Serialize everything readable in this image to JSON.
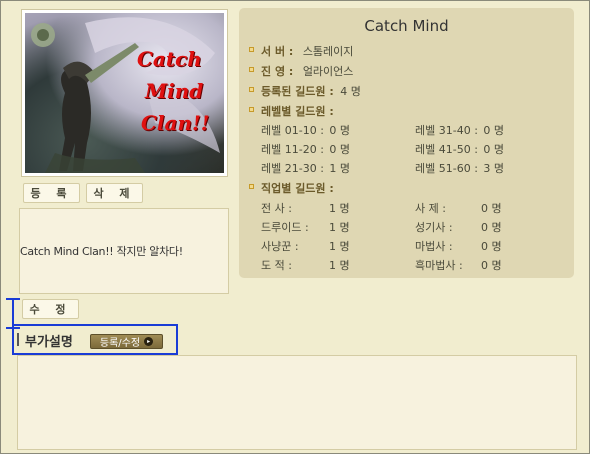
{
  "guild_image": {
    "caption_lines": [
      "Catch",
      "Mind",
      "Clan!!"
    ],
    "caption_color": "#e01010"
  },
  "buttons": {
    "register": "등 록",
    "delete": "삭 제",
    "edit": "수 정"
  },
  "intro_text": "Catch Mind Clan!! 작지만 알차다!",
  "info": {
    "title": "Catch Mind",
    "server_label": "서 버 :",
    "server_value": "스톰레이지",
    "faction_label": "진 영 :",
    "faction_value": "얼라이언스",
    "members_label": "등록된 길드원 :",
    "members_value": "4 명",
    "level_header": "레벨별 길드원 :",
    "levels": [
      {
        "label": "레벨 01-10 :",
        "value": "0 명"
      },
      {
        "label": "레벨 31-40 :",
        "value": "0 명"
      },
      {
        "label": "레벨 11-20 :",
        "value": "0 명"
      },
      {
        "label": "레벨 41-50 :",
        "value": "0 명"
      },
      {
        "label": "레벨 21-30 :",
        "value": "1 명"
      },
      {
        "label": "레벨 51-60 :",
        "value": "3 명"
      }
    ],
    "class_header": "직업별 길드원 :",
    "classes": [
      {
        "label": "전 사 :",
        "value": "1 명"
      },
      {
        "label": "사 제 :",
        "value": "0 명"
      },
      {
        "label": "드루이드 :",
        "value": "1 명"
      },
      {
        "label": "성기사 :",
        "value": "0 명"
      },
      {
        "label": "사냥꾼 :",
        "value": "1 명"
      },
      {
        "label": "마법사 :",
        "value": "0 명"
      },
      {
        "label": "도 적 :",
        "value": "1 명"
      },
      {
        "label": "흑마법사 :",
        "value": "0 명"
      }
    ]
  },
  "extra_section": {
    "title": "부가설명",
    "button_label": "등록/수정",
    "button_icon": "arrow-right-circle-icon"
  },
  "colors": {
    "highlight_frame": "#1a3cd6",
    "panel_bg": "#dfd7b3",
    "page_bg": "#f1edcf"
  }
}
